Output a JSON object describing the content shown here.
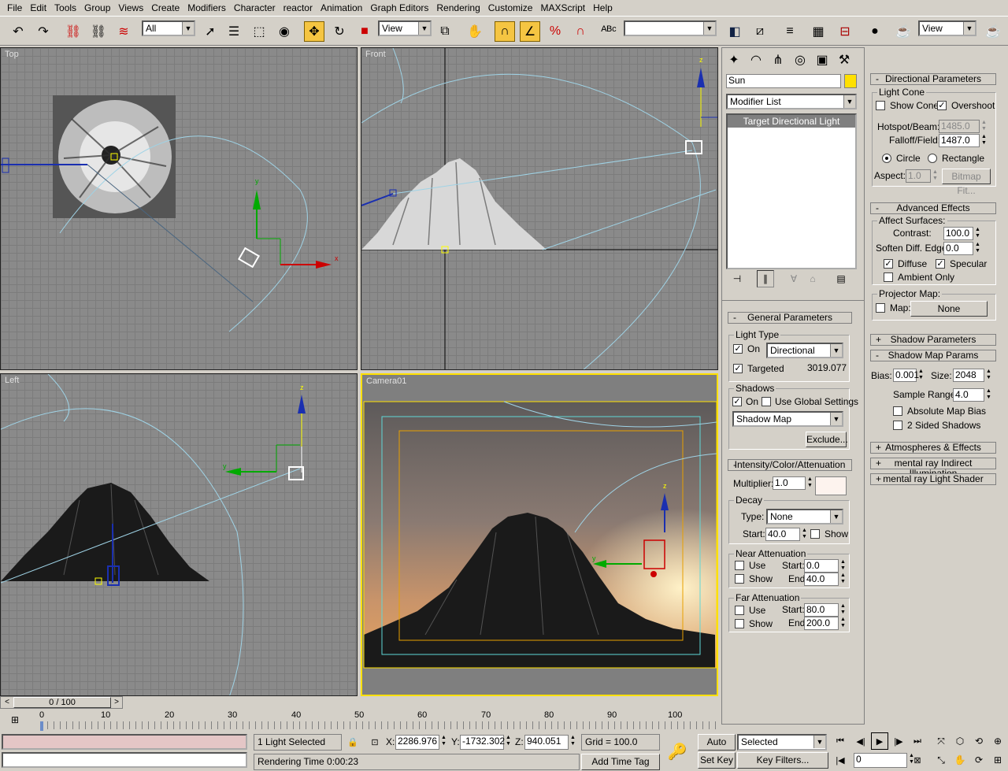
{
  "menu": [
    "File",
    "Edit",
    "Tools",
    "Group",
    "Views",
    "Create",
    "Modifiers",
    "Character",
    "reactor",
    "Animation",
    "Graph Editors",
    "Rendering",
    "Customize",
    "MAXScript",
    "Help"
  ],
  "toolbar": {
    "selection_filter": "All",
    "ref_coord": "View",
    "ref_coord_right": "View",
    "named_selection": ""
  },
  "viewports": {
    "top": "Top",
    "front": "Front",
    "left": "Left",
    "camera": "Camera01"
  },
  "create_panel": {
    "object_name": "Sun",
    "modifier_list": "Modifier List",
    "stack_item": "Target Directional Light"
  },
  "general": {
    "title": "General Parameters",
    "light_type_group": "Light Type",
    "on_label": "On",
    "light_type": "Directional",
    "targeted_label": "Targeted",
    "target_distance": "3019.077",
    "shadows_group": "Shadows",
    "shadows_on_label": "On",
    "use_global": "Use Global Settings",
    "shadow_type": "Shadow Map",
    "exclude": "Exclude..."
  },
  "intensity": {
    "title": "Intensity/Color/Attenuation",
    "multiplier_label": "Multiplier:",
    "multiplier": "1.0",
    "color": "#fdf3ee",
    "decay_group": "Decay",
    "type_label": "Type:",
    "decay_type": "None",
    "start_label": "Start:",
    "decay_start": "40.0",
    "show_label": "Show",
    "near_group": "Near Attenuation",
    "use_label": "Use",
    "near_start": "0.0",
    "near_end": "40.0",
    "end_label": "End:",
    "far_group": "Far Attenuation",
    "far_start": "80.0",
    "far_end": "200.0"
  },
  "directional": {
    "title": "Directional Parameters",
    "light_cone": "Light Cone",
    "show_cone": "Show Cone",
    "overshoot": "Overshoot",
    "hotspot_label": "Hotspot/Beam:",
    "hotspot": "1485.0",
    "falloff_label": "Falloff/Field:",
    "falloff": "1487.0",
    "circle": "Circle",
    "rectangle": "Rectangle",
    "aspect_label": "Aspect:",
    "aspect": "1.0",
    "bitmap_fit": "Bitmap Fit..."
  },
  "advanced": {
    "title": "Advanced Effects",
    "affect": "Affect Surfaces:",
    "contrast_label": "Contrast:",
    "contrast": "100.0",
    "soften_label": "Soften Diff. Edge:",
    "soften": "0.0",
    "diffuse": "Diffuse",
    "specular": "Specular",
    "ambient": "Ambient Only",
    "projector": "Projector Map:",
    "map_label": "Map:",
    "map_value": "None"
  },
  "rollouts": {
    "shadow_params": "Shadow Parameters",
    "shadow_map_params": "Shadow Map Params",
    "atmos": "Atmospheres & Effects",
    "mr_indirect": "mental ray Indirect Illumination",
    "mr_shader": "mental ray Light Shader"
  },
  "shadowmap": {
    "bias_label": "Bias:",
    "bias": "0.001",
    "size_label": "Size:",
    "size": "2048",
    "sample_label": "Sample Range:",
    "sample": "4.0",
    "abs_bias": "Absolute Map Bias",
    "two_sided": "2 Sided Shadows"
  },
  "timeline": {
    "frame": "0 / 100",
    "ticks": [
      "0",
      "10",
      "20",
      "30",
      "40",
      "50",
      "60",
      "70",
      "80",
      "90",
      "100"
    ]
  },
  "status": {
    "selected": "1 Light Selected",
    "rendering": "Rendering Time  0:00:23",
    "x_label": "X:",
    "x": "2286.976",
    "y_label": "Y:",
    "y": "-1732.302",
    "z_label": "Z:",
    "z": "940.051",
    "grid": "Grid = 100.0",
    "add_time_tag": "Add Time Tag",
    "auto_key": "Auto Key",
    "set_key": "Set Key",
    "selected_dd": "Selected",
    "key_filters": "Key Filters...",
    "frame_field": "0"
  }
}
